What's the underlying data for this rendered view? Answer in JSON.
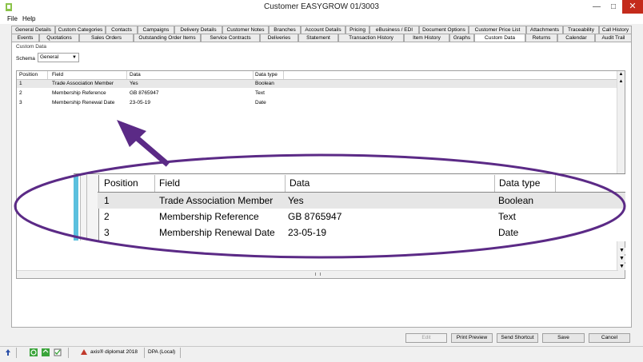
{
  "window": {
    "title": "Customer EASYGROW 01/3003",
    "min": "—",
    "max": "□",
    "close": "✕"
  },
  "menu": [
    "File",
    "Help"
  ],
  "tabs_row1": [
    "General Details",
    "Custom Categories",
    "Contacts",
    "Campaigns",
    "Delivery Details",
    "Customer Notes",
    "Branches",
    "Account Details",
    "Pricing",
    "eBusiness / EDI",
    "Document Options",
    "Customer Price List",
    "Attachments",
    "Traceability",
    "Call History"
  ],
  "tabs_row2": [
    "Events",
    "Quotations",
    "Sales Orders",
    "Outstanding Order Items",
    "Service Contracts",
    "Deliveries",
    "Statement",
    "Transaction History",
    "Item History",
    "Graphs",
    "Custom Data",
    "Returns",
    "Calendar",
    "Audit Trail"
  ],
  "active_tab": "Custom Data",
  "panel": {
    "group_label": "Custom Data",
    "schema_label": "Schema",
    "schema_value": "General"
  },
  "grid": {
    "columns": [
      "Position",
      "Field",
      "Data",
      "Data type"
    ],
    "rows": [
      {
        "position": "1",
        "field": "Trade Association Member",
        "data": "Yes",
        "type": "Boolean"
      },
      {
        "position": "2",
        "field": "Membership Reference",
        "data": "GB 8765947",
        "type": "Text"
      },
      {
        "position": "3",
        "field": "Membership Renewal Date",
        "data": "23-05-19",
        "type": "Date"
      }
    ]
  },
  "buttons": {
    "edit": "Edit",
    "print_preview": "Print Preview",
    "send_shortcut": "Send Shortcut",
    "save": "Save",
    "cancel": "Cancel"
  },
  "status": {
    "product": "axis® diplomat 2018",
    "dpa": "DPA (Local)"
  },
  "colors": {
    "accent_purple": "#5b2a86",
    "highlight_blue": "#5bc0de",
    "close_red": "#c42b1c"
  }
}
